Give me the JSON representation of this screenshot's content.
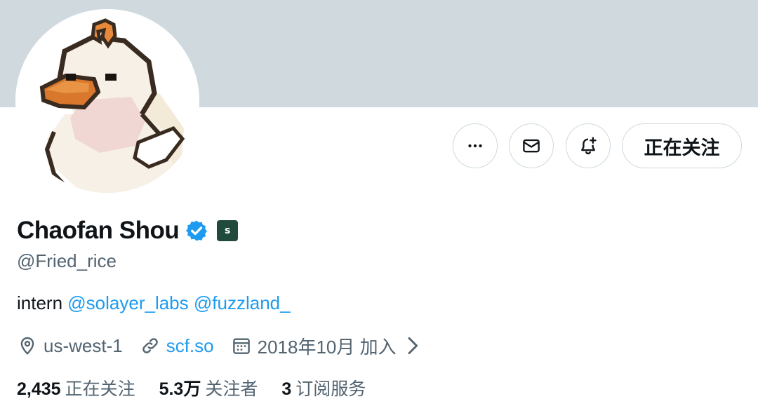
{
  "profile": {
    "display_name": "Chaofan Shou",
    "handle": "@Fried_rice",
    "affiliate_badge": "s",
    "bio": {
      "text": "intern",
      "mentions": [
        "@solayer_labs",
        "@fuzzland_"
      ]
    },
    "location": "us-west-1",
    "website": "scf.so",
    "joined": "2018年10月 加入"
  },
  "actions": {
    "more_icon": "more-horizontal-icon",
    "message_icon": "mail-icon",
    "notify_icon": "bell-plus-icon",
    "follow_label": "正在关注"
  },
  "stats": {
    "following_value": "2,435",
    "following_label": "正在关注",
    "followers_value": "5.3万",
    "followers_label": "关注者",
    "subscriptions_value": "3",
    "subscriptions_label": "订阅服务"
  },
  "colors": {
    "banner": "#cfd9de",
    "link": "#1d9bf0",
    "verified": "#1d9bf0",
    "secondary_text": "#536471",
    "affiliate_badge": "#1f4a3c"
  }
}
